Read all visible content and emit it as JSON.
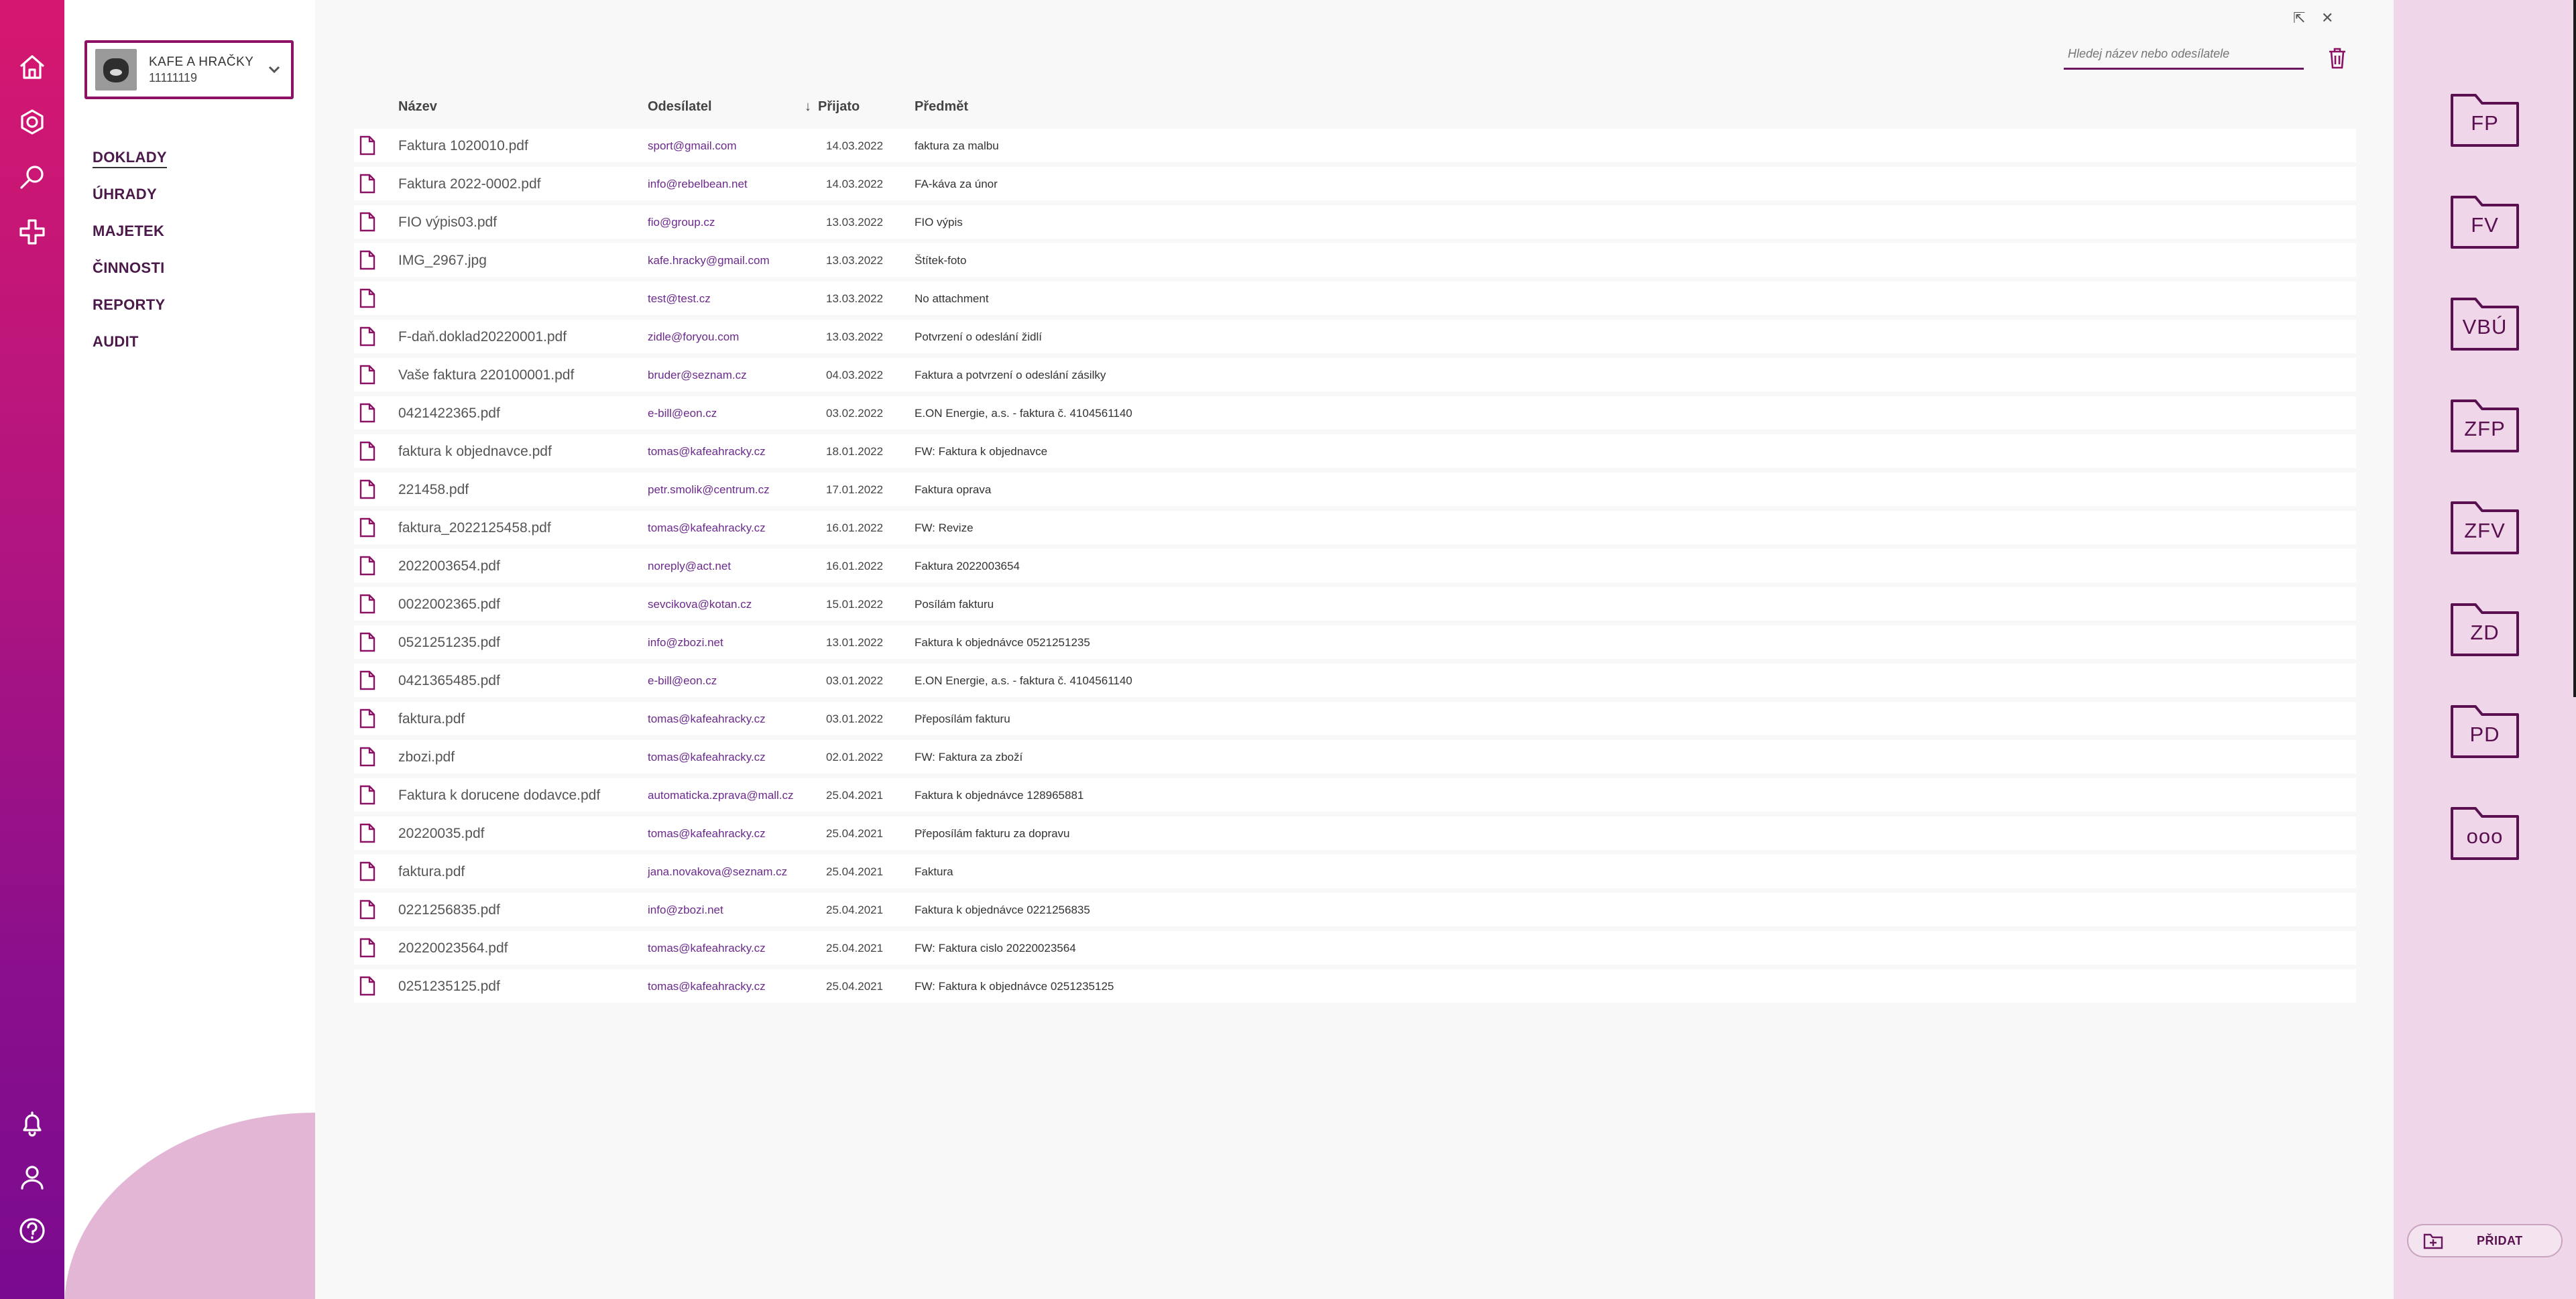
{
  "company": {
    "name": "KAFE A HRAČKY",
    "id": "11111119"
  },
  "menu": [
    {
      "label": "DOKLADY",
      "active": true
    },
    {
      "label": "ÚHRADY"
    },
    {
      "label": "MAJETEK"
    },
    {
      "label": "ČINNOSTI"
    },
    {
      "label": "REPORTY"
    },
    {
      "label": "AUDIT"
    }
  ],
  "search": {
    "placeholder": "Hledej název nebo odesílatele"
  },
  "table": {
    "headers": {
      "name": "Název",
      "from": "Odesílatel",
      "date": "Přijato",
      "subject": "Předmět"
    },
    "sort_indicator": "↓",
    "rows": [
      {
        "name": "Faktura 1020010.pdf",
        "from": "sport@gmail.com",
        "date": "14.03.2022",
        "subject": "faktura za malbu"
      },
      {
        "name": "Faktura 2022-0002.pdf",
        "from": "info@rebelbean.net",
        "date": "14.03.2022",
        "subject": "FA-káva za únor"
      },
      {
        "name": "FIO výpis03.pdf",
        "from": "fio@group.cz",
        "date": "13.03.2022",
        "subject": "FIO výpis"
      },
      {
        "name": "IMG_2967.jpg",
        "from": "kafe.hracky@gmail.com",
        "date": "13.03.2022",
        "subject": "Štítek-foto"
      },
      {
        "name": "",
        "from": "test@test.cz",
        "date": "13.03.2022",
        "subject": "No attachment"
      },
      {
        "name": "F-daň.doklad20220001.pdf",
        "from": "zidle@foryou.com",
        "date": "13.03.2022",
        "subject": "Potvrzení o odeslání židlí"
      },
      {
        "name": "Vaše faktura 220100001.pdf",
        "from": "bruder@seznam.cz",
        "date": "04.03.2022",
        "subject": "Faktura a potvrzení o odeslání zásilky"
      },
      {
        "name": "0421422365.pdf",
        "from": "e-bill@eon.cz",
        "date": "03.02.2022",
        "subject": "E.ON Energie, a.s. - faktura č. 4104561140"
      },
      {
        "name": "faktura k objednavce.pdf",
        "from": "tomas@kafeahracky.cz",
        "date": "18.01.2022",
        "subject": "FW: Faktura k objednavce"
      },
      {
        "name": "221458.pdf",
        "from": "petr.smolik@centrum.cz",
        "date": "17.01.2022",
        "subject": "Faktura oprava"
      },
      {
        "name": "faktura_2022125458.pdf",
        "from": "tomas@kafeahracky.cz",
        "date": "16.01.2022",
        "subject": "FW: Revize"
      },
      {
        "name": "2022003654.pdf",
        "from": "noreply@act.net",
        "date": "16.01.2022",
        "subject": "Faktura 2022003654"
      },
      {
        "name": "0022002365.pdf",
        "from": "sevcikova@kotan.cz",
        "date": "15.01.2022",
        "subject": "Posílám fakturu"
      },
      {
        "name": "0521251235.pdf",
        "from": "info@zbozi.net",
        "date": "13.01.2022",
        "subject": "Faktura k objednávce 0521251235"
      },
      {
        "name": "0421365485.pdf",
        "from": "e-bill@eon.cz",
        "date": "03.01.2022",
        "subject": "E.ON Energie, a.s. - faktura č. 4104561140"
      },
      {
        "name": "faktura.pdf",
        "from": "tomas@kafeahracky.cz",
        "date": "03.01.2022",
        "subject": "Přeposílám fakturu"
      },
      {
        "name": "zbozi.pdf",
        "from": "tomas@kafeahracky.cz",
        "date": "02.01.2022",
        "subject": "FW: Faktura za zboží"
      },
      {
        "name": "Faktura k dorucene dodavce.pdf",
        "from": "automaticka.zprava@mall.cz",
        "date": "25.04.2021",
        "subject": "Faktura k objednávce 128965881"
      },
      {
        "name": "20220035.pdf",
        "from": "tomas@kafeahracky.cz",
        "date": "25.04.2021",
        "subject": "Přeposílám fakturu za dopravu"
      },
      {
        "name": "faktura.pdf",
        "from": "jana.novakova@seznam.cz",
        "date": "25.04.2021",
        "subject": "Faktura"
      },
      {
        "name": "0221256835.pdf",
        "from": "info@zbozi.net",
        "date": "25.04.2021",
        "subject": "Faktura k objednávce 0221256835"
      },
      {
        "name": "20220023564.pdf",
        "from": "tomas@kafeahracky.cz",
        "date": "25.04.2021",
        "subject": "FW: Faktura cislo 20220023564"
      },
      {
        "name": "0251235125.pdf",
        "from": "tomas@kafeahracky.cz",
        "date": "25.04.2021",
        "subject": "FW: Faktura k objednávce 0251235125"
      }
    ]
  },
  "folders": [
    "FP",
    "FV",
    "VBÚ",
    "ZFP",
    "ZFV",
    "ZD",
    "PD",
    "ooo"
  ],
  "add_button": {
    "label": "PŘIDAT"
  },
  "window_controls": {
    "popout": "⇱",
    "close": "✕"
  },
  "colors": {
    "brand": "#8a1163",
    "rail_top": "#d6176f",
    "rail_bottom": "#7a0a8f",
    "right_panel": "#efd6e9"
  }
}
